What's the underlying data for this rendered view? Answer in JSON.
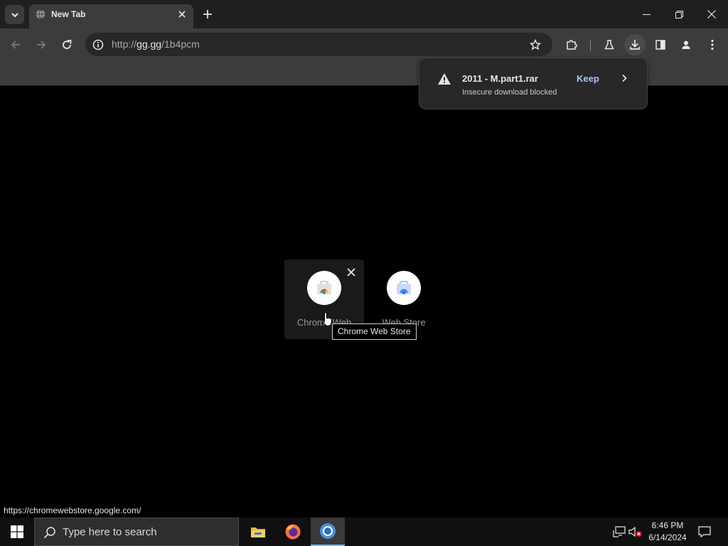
{
  "browser": {
    "tab": {
      "title": "New Tab"
    },
    "address": {
      "url_prefix": "http://",
      "url_host": "gg.gg",
      "url_path": "/1b4pcm"
    }
  },
  "download": {
    "filename": "2011 - M.part1.rar",
    "status": "Insecure download blocked",
    "keep_label": "Keep"
  },
  "shortcuts": [
    {
      "label": "Chrome Web Store",
      "display_label": "Chrome Web"
    },
    {
      "label": "Web Store",
      "display_label": "Web Store"
    }
  ],
  "tooltip": {
    "text": "Chrome Web Store"
  },
  "status_bar": {
    "url": "https://chromewebstore.google.com/"
  },
  "taskbar": {
    "search_placeholder": "Type here to search",
    "time": "6:46 PM",
    "date": "6/14/2024"
  },
  "icons": {
    "tab_search": "chevron-down-icon",
    "close": "close-icon",
    "new_tab": "plus-icon",
    "back": "arrow-left-icon",
    "forward": "arrow-right-icon",
    "reload": "reload-icon",
    "site_info": "info-icon",
    "bookmark": "star-icon",
    "extensions": "puzzle-icon",
    "labs": "flask-icon",
    "downloads": "download-icon",
    "side_panel": "side-panel-icon",
    "profile": "person-icon",
    "menu": "kebab-icon",
    "warning": "warning-icon",
    "start": "windows-logo-icon",
    "search": "search-icon"
  },
  "colors": {
    "accent_link": "#a8c7fa",
    "taskbar_active": "#76b9ed"
  }
}
